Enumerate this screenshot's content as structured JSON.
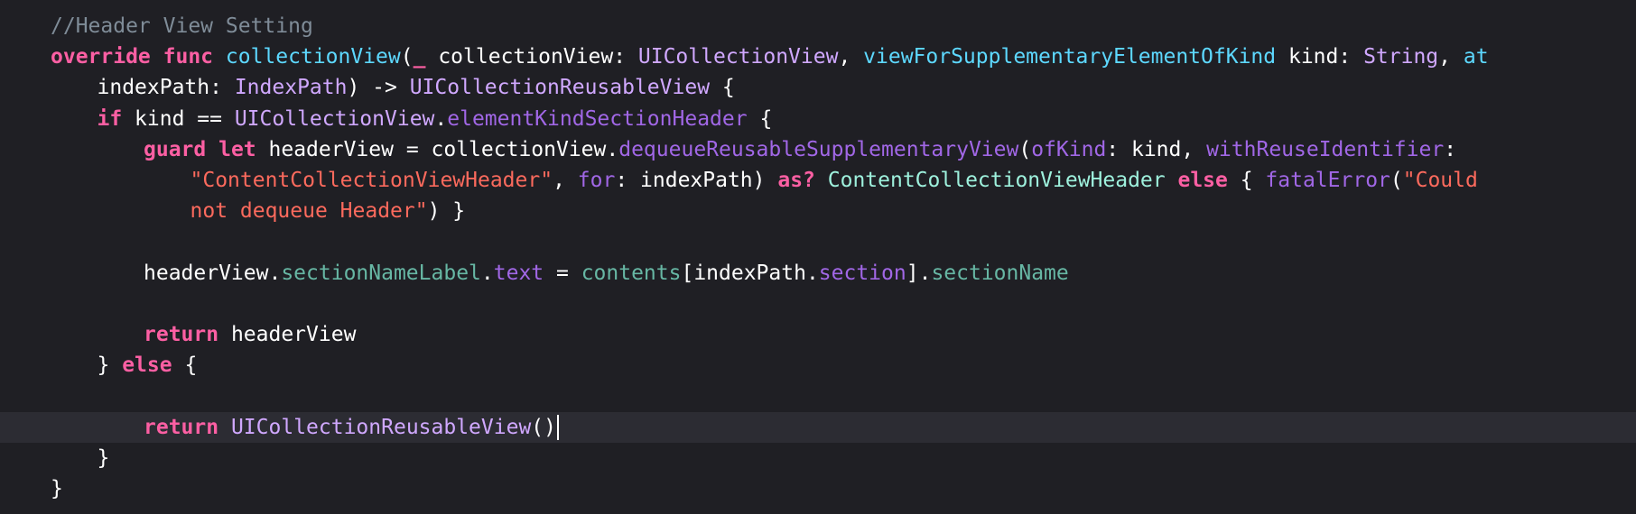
{
  "editor": {
    "colors": {
      "background": "#1f1f24",
      "current_line": "#2c2c33",
      "comment": "#7f8c98",
      "keyword": "#fc5fa3",
      "type": "#d0a8ff",
      "project_member": "#67b7a4",
      "project_call": "#a167e6",
      "project_type": "#9ef1dd",
      "string": "#fc6a5d",
      "plain": "#ffffff"
    },
    "lines": [
      {
        "indent": 0,
        "tokens": [
          {
            "c": "comment",
            "t": "//Header View Setting"
          }
        ]
      },
      {
        "indent": 0,
        "tokens": [
          {
            "c": "keyword",
            "t": "override"
          },
          {
            "c": "plain",
            "t": " "
          },
          {
            "c": "keyword",
            "t": "func"
          },
          {
            "c": "plain",
            "t": " "
          },
          {
            "c": "attr",
            "t": "collectionView"
          },
          {
            "c": "plain",
            "t": "("
          },
          {
            "c": "keyword",
            "t": "_"
          },
          {
            "c": "plain",
            "t": " collectionView: "
          },
          {
            "c": "type",
            "t": "UICollectionView"
          },
          {
            "c": "plain",
            "t": ", "
          },
          {
            "c": "attr",
            "t": "viewForSupplementaryElementOfKind"
          },
          {
            "c": "plain",
            "t": " kind: "
          },
          {
            "c": "type",
            "t": "String"
          },
          {
            "c": "plain",
            "t": ", "
          },
          {
            "c": "attr",
            "t": "at"
          }
        ]
      },
      {
        "indent": 1,
        "tokens": [
          {
            "c": "plain",
            "t": "indexPath: "
          },
          {
            "c": "type",
            "t": "IndexPath"
          },
          {
            "c": "plain",
            "t": ") -> "
          },
          {
            "c": "type",
            "t": "UICollectionReusableView"
          },
          {
            "c": "plain",
            "t": " {"
          }
        ]
      },
      {
        "indent": 1,
        "tokens": [
          {
            "c": "keyword",
            "t": "if"
          },
          {
            "c": "plain",
            "t": " kind == "
          },
          {
            "c": "type",
            "t": "UICollectionView"
          },
          {
            "c": "plain",
            "t": "."
          },
          {
            "c": "projfunc",
            "t": "elementKindSectionHeader"
          },
          {
            "c": "plain",
            "t": " {"
          }
        ]
      },
      {
        "indent": 2,
        "tokens": [
          {
            "c": "keyword",
            "t": "guard"
          },
          {
            "c": "plain",
            "t": " "
          },
          {
            "c": "keyword",
            "t": "let"
          },
          {
            "c": "plain",
            "t": " headerView = collectionView."
          },
          {
            "c": "projfunc",
            "t": "dequeueReusableSupplementaryView"
          },
          {
            "c": "plain",
            "t": "("
          },
          {
            "c": "projfunc",
            "t": "ofKind"
          },
          {
            "c": "plain",
            "t": ": kind, "
          },
          {
            "c": "projfunc",
            "t": "withReuseIdentifier"
          },
          {
            "c": "plain",
            "t": ":"
          }
        ]
      },
      {
        "indent": 3,
        "tokens": [
          {
            "c": "string",
            "t": "\"ContentCollectionViewHeader\""
          },
          {
            "c": "plain",
            "t": ", "
          },
          {
            "c": "projfunc",
            "t": "for"
          },
          {
            "c": "plain",
            "t": ": indexPath) "
          },
          {
            "c": "keyword",
            "t": "as?"
          },
          {
            "c": "plain",
            "t": " "
          },
          {
            "c": "projtype",
            "t": "ContentCollectionViewHeader"
          },
          {
            "c": "plain",
            "t": " "
          },
          {
            "c": "keyword",
            "t": "else"
          },
          {
            "c": "plain",
            "t": " { "
          },
          {
            "c": "projfunc",
            "t": "fatalError"
          },
          {
            "c": "plain",
            "t": "("
          },
          {
            "c": "string",
            "t": "\"Could"
          }
        ]
      },
      {
        "indent": 3,
        "tokens": [
          {
            "c": "string",
            "t": "not dequeue Header\""
          },
          {
            "c": "plain",
            "t": ") }"
          }
        ]
      },
      {
        "indent": 0,
        "tokens": []
      },
      {
        "indent": 2,
        "tokens": [
          {
            "c": "plain",
            "t": "headerView."
          },
          {
            "c": "func",
            "t": "sectionNameLabel"
          },
          {
            "c": "plain",
            "t": "."
          },
          {
            "c": "projfunc",
            "t": "text"
          },
          {
            "c": "plain",
            "t": " = "
          },
          {
            "c": "func",
            "t": "contents"
          },
          {
            "c": "plain",
            "t": "[indexPath."
          },
          {
            "c": "projfunc",
            "t": "section"
          },
          {
            "c": "plain",
            "t": "]."
          },
          {
            "c": "func",
            "t": "sectionName"
          }
        ]
      },
      {
        "indent": 0,
        "tokens": []
      },
      {
        "indent": 2,
        "tokens": [
          {
            "c": "keyword",
            "t": "return"
          },
          {
            "c": "plain",
            "t": " headerView"
          }
        ]
      },
      {
        "indent": 1,
        "tokens": [
          {
            "c": "plain",
            "t": "} "
          },
          {
            "c": "keyword",
            "t": "else"
          },
          {
            "c": "plain",
            "t": " {"
          }
        ]
      },
      {
        "indent": 0,
        "tokens": []
      },
      {
        "indent": 2,
        "current": true,
        "cursor": true,
        "tokens": [
          {
            "c": "keyword",
            "t": "return"
          },
          {
            "c": "plain",
            "t": " "
          },
          {
            "c": "type",
            "t": "UICollectionReusableView"
          },
          {
            "c": "plain",
            "t": "()"
          }
        ]
      },
      {
        "indent": 1,
        "tokens": [
          {
            "c": "plain",
            "t": "}"
          }
        ]
      },
      {
        "indent": 0,
        "tokens": [
          {
            "c": "plain",
            "t": "}"
          }
        ]
      }
    ]
  }
}
